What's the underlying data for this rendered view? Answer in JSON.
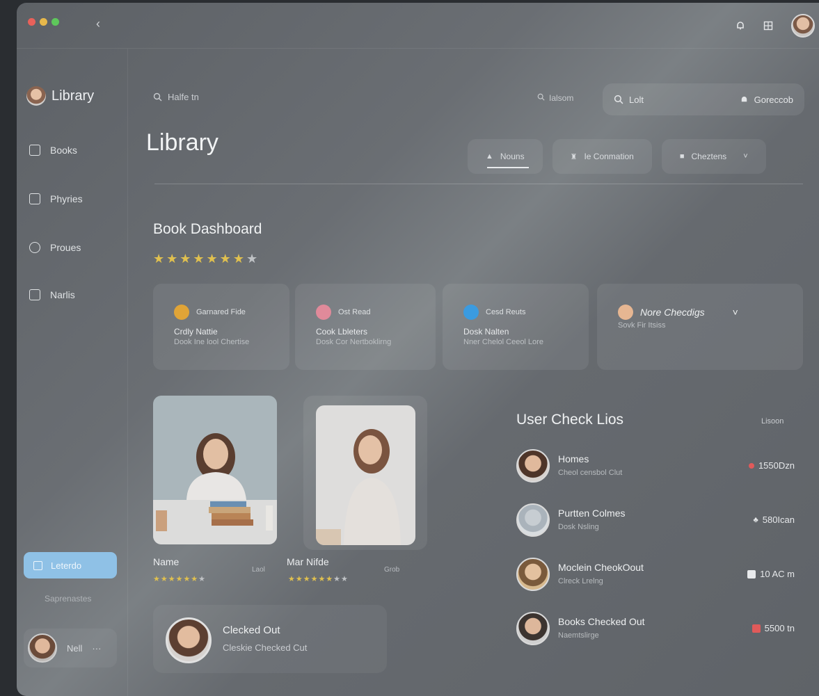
{
  "window": {
    "controls": [
      "close",
      "minimize",
      "maximize"
    ],
    "dot_colors": [
      "#e8615a",
      "#e7b84b",
      "#5ec75b"
    ]
  },
  "topbar": {
    "back_icon": "chevron-left-icon",
    "icons": [
      "bell-icon",
      "grid-icon"
    ],
    "avatar": "user-avatar"
  },
  "sidebar": {
    "brand": "Library",
    "items": [
      {
        "label": "Books",
        "icon": "book-icon"
      },
      {
        "label": "Phyries",
        "icon": "list-icon"
      },
      {
        "label": "Proues",
        "icon": "circle-icon"
      },
      {
        "label": "Narlis",
        "icon": "grid-icon"
      }
    ],
    "cta_label": "Leterdo",
    "sub_label": "Saprenastes",
    "user_name": "Nell",
    "user_more": "···"
  },
  "main": {
    "search_left": "Halfe tn",
    "search_right_a": "Ialsom",
    "searchbox_value": "Lolt",
    "searchbox_action": "Goreccob",
    "title": "Library",
    "tabs": [
      {
        "label": "Nouns",
        "icon": "home-icon"
      },
      {
        "label": "Ie Conmation",
        "icon": "bookmark-icon"
      },
      {
        "label": "Cheztens",
        "icon": "folder-icon"
      }
    ],
    "section_title": "Book Dashboard",
    "rating_stars": {
      "filled": 7,
      "total": 8
    },
    "cards": [
      {
        "head": "Garnared Fide",
        "l1": "Crdly Nattie",
        "l2": "Dook Ine lool Chertise",
        "badge_color": "#e0a437"
      },
      {
        "head": "Ost Read",
        "l1": "Cook Lbleters",
        "l2": "Dosk Cor Nertboklirng",
        "badge_color": "#e08a9a"
      },
      {
        "head": "Cesd Reuts",
        "l1": "Dosk Nalten",
        "l2": "Nner Chelol Ceeol Lore",
        "badge_color": "#3b9be0"
      },
      {
        "head": "Nore Checdigs",
        "l1": "",
        "l2": "Sovk Fir Itsiss",
        "badge_color": "#e6b692"
      }
    ],
    "photos": [
      {
        "name": "Name",
        "side": "Laol",
        "stars_filled": 6,
        "stars_total": 7
      },
      {
        "name": "Mar Nifde",
        "side": "Grob",
        "stars_filled": 6,
        "stars_total": 8
      }
    ],
    "checked": {
      "title": "Clecked Out",
      "subtitle": "Cleskie Checked Cut"
    },
    "user_check": {
      "title": "User Check Lios",
      "right_label": "Lisoon",
      "rows": [
        {
          "name": "Homes",
          "sub": "Cheol censbol Clut",
          "value": "1550Dzn",
          "mark_color": "#e05a5a"
        },
        {
          "name": "Purtten Colmes",
          "sub": "Dosk Nsling",
          "value": "580Ican",
          "mark_color": "#c8cbce"
        },
        {
          "name": "Moclein CheokOout",
          "sub": "Clreck Lrelng",
          "value": "10 AC m",
          "mark_color": "#e8eaec"
        },
        {
          "name": "Books Checked Out",
          "sub": "Naemtslirge",
          "value": "5500 tn",
          "mark_color": "#e05a5a"
        }
      ]
    }
  }
}
